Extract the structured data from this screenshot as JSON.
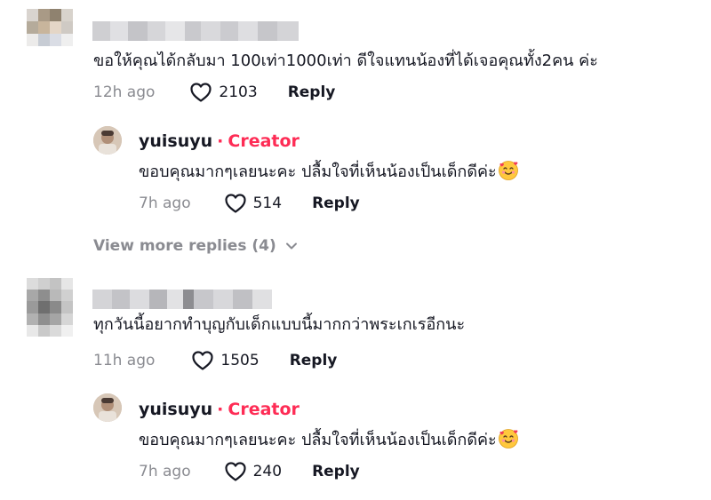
{
  "comments": [
    {
      "text": "ขอให้คุณได้กลับมา 100เท่า1000เท่า ดีใจแทนน้องที่ได้เจอคุณทั้ง2คน ค่ะ",
      "time": "12h ago",
      "likes": "2103",
      "reply_label": "Reply",
      "reply": {
        "username": "yuisuyu",
        "separator": "·",
        "badge": "Creator",
        "text": "ขอบคุณมากๆเลยนะคะ ปลื้มใจที่เห็นน้องเป็นเด็กดีค่ะ",
        "emoji": "smiling-face-with-hearts",
        "time": "7h ago",
        "likes": "514",
        "reply_label": "Reply"
      },
      "view_more": "View more replies (4)"
    },
    {
      "text": "ทุกวันนี้อยากทำบุญกับเด็กแบบนี้มากกว่าพระเกเรอีกนะ",
      "time": "11h ago",
      "likes": "1505",
      "reply_label": "Reply",
      "reply": {
        "username": "yuisuyu",
        "separator": "·",
        "badge": "Creator",
        "text": "ขอบคุณมากๆเลยนะคะ ปลื้มใจที่เห็นน้องเป็นเด็กดีค่ะ",
        "emoji": "smiling-face-with-hearts",
        "time": "7h ago",
        "likes": "240",
        "reply_label": "Reply"
      }
    }
  ],
  "colors": {
    "creator": "#fe2c55",
    "muted": "#8a8b91",
    "text": "#161823"
  },
  "icons": {
    "like": "heart-outline-icon",
    "expand": "chevron-down-icon"
  }
}
